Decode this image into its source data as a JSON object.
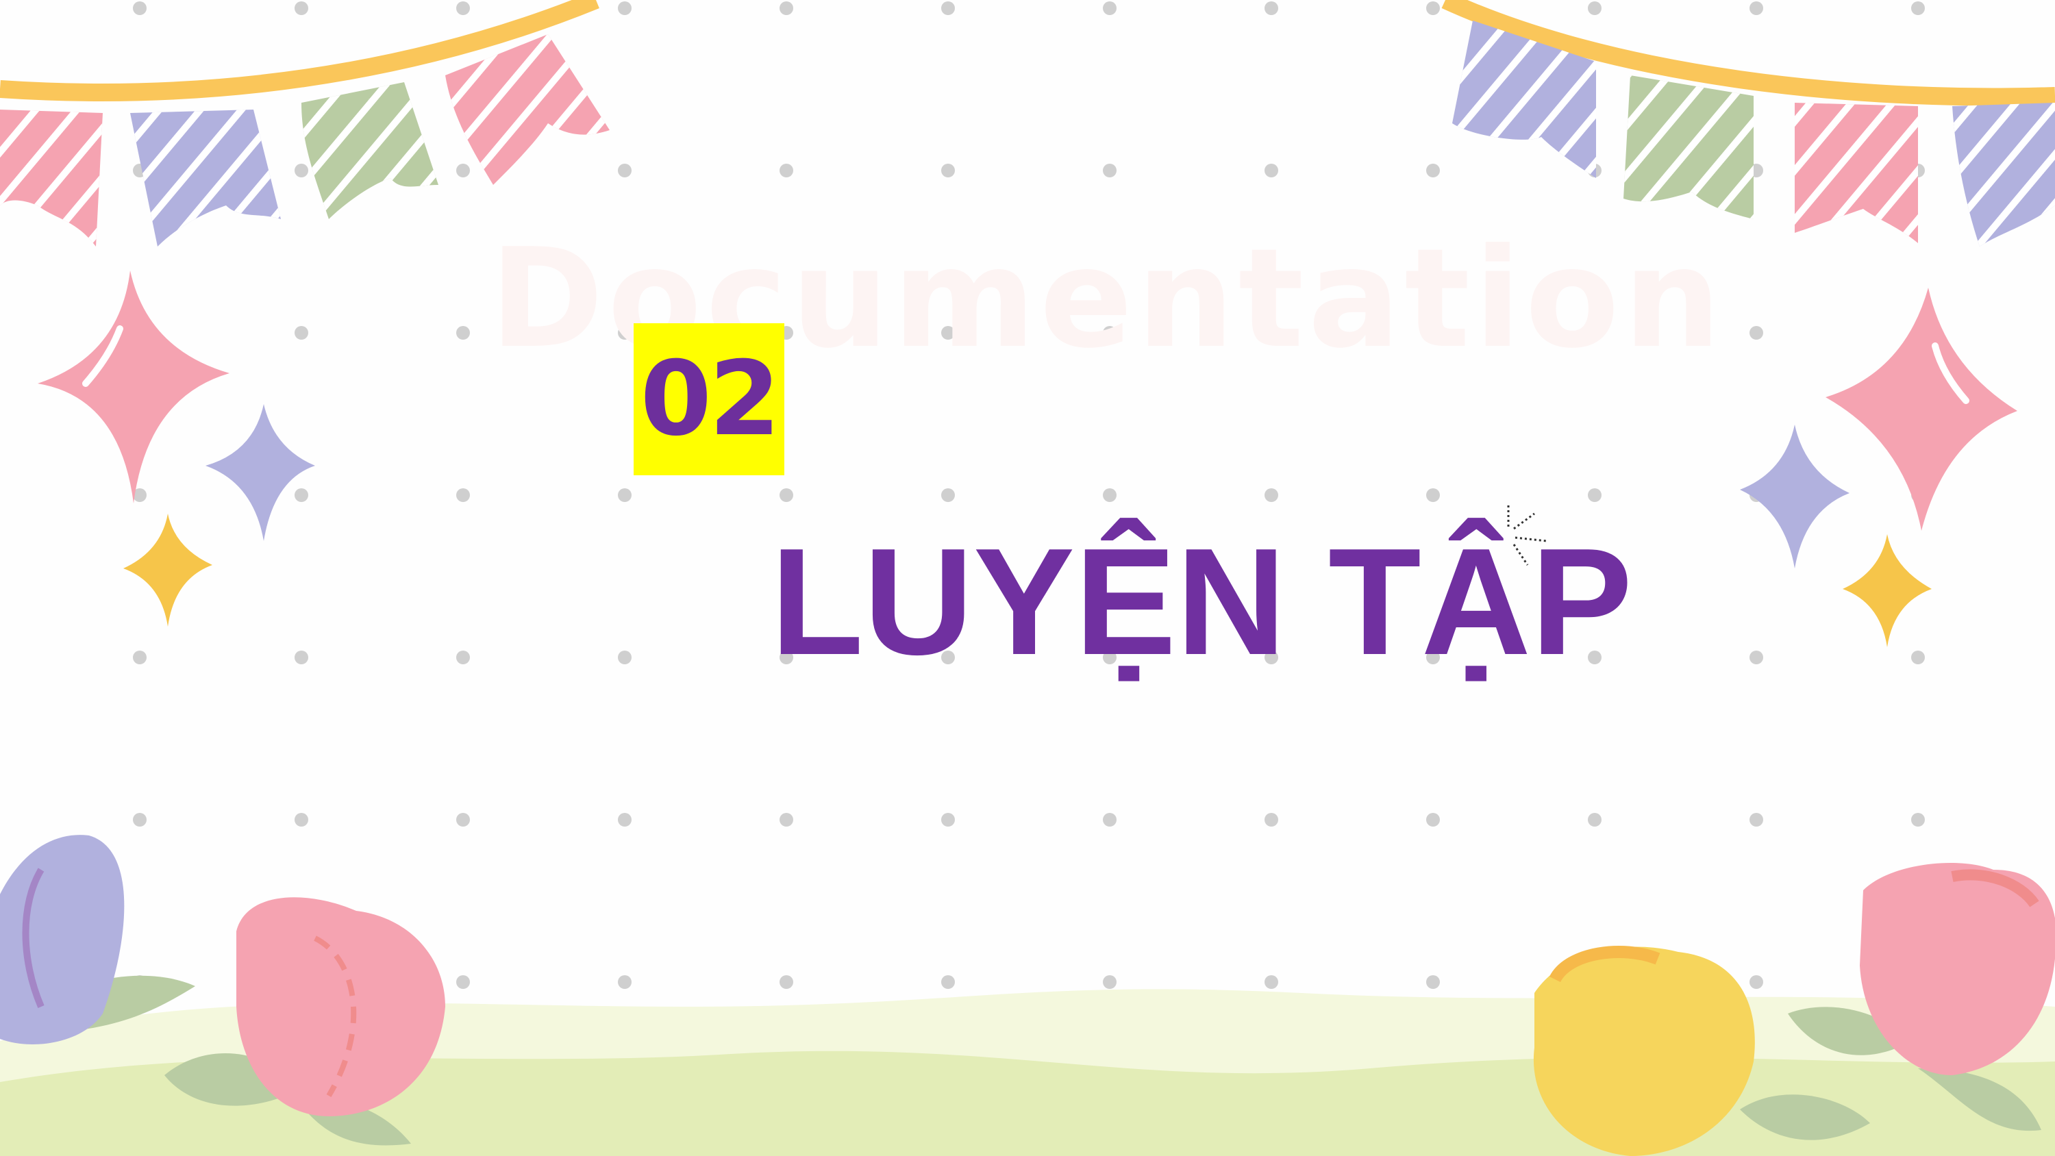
{
  "slide": {
    "watermark": "Documentation",
    "number": "02",
    "title": "LUYỆN TẬP"
  },
  "colors": {
    "title": "#7030a0",
    "number_bg": "#ffff00",
    "number_text": "#6d2f9c",
    "pink": "#f5a3b1",
    "lavender": "#b1b1de",
    "sage": "#b9cca3",
    "yellow": "#f6c54a",
    "string": "#fac65a",
    "grass": "#e3edb7",
    "dots": "#cfcfcf"
  },
  "icons": [
    "bunting-left-decoration",
    "bunting-right-decoration",
    "sparkle-star-icon",
    "tulip-flower-icon",
    "dot-grid-pattern",
    "grass-hills-decoration"
  ]
}
